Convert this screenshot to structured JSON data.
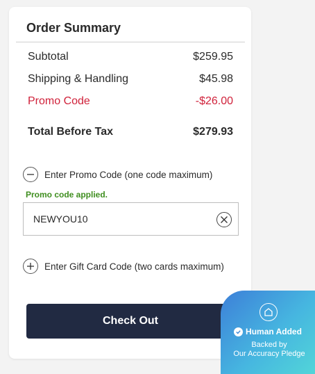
{
  "summary": {
    "title": "Order Summary",
    "subtotal_label": "Subtotal",
    "subtotal_value": "$259.95",
    "shipping_label": "Shipping & Handling",
    "shipping_value": "$45.98",
    "promo_label": "Promo Code",
    "promo_value": "-$26.00",
    "total_label": "Total Before Tax",
    "total_value": "$279.93"
  },
  "promo": {
    "toggle_label": "Enter Promo Code (one code maximum)",
    "status_text": "Promo code applied.",
    "code_value": "NEWYOU10"
  },
  "gift": {
    "toggle_label": "Enter Gift Card Code (two cards maximum)"
  },
  "checkout": {
    "label": "Check Out"
  },
  "badge": {
    "title": "Human Added",
    "line1": "Backed by",
    "line2": "Our Accuracy Pledge"
  },
  "colors": {
    "promo_red": "#d0213a",
    "applied_green": "#3f8e1f",
    "checkout_bg": "#212a42"
  }
}
